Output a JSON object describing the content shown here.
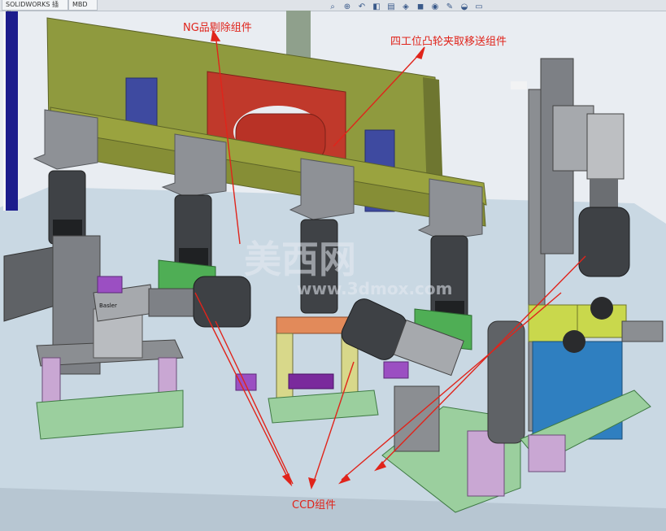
{
  "tabs": [
    "SOLIDWORKS 插件",
    "MBD"
  ],
  "toolbar_icons": [
    "zoom-fit-icon",
    "zoom-area-icon",
    "previous-view-icon",
    "section-view-icon",
    "dynamic-annotation-icon",
    "view-orientation-icon",
    "display-style-icon",
    "hide-show-icon",
    "edit-appearance-icon",
    "apply-scene-icon",
    "view-settings-icon"
  ],
  "annotations": {
    "ng": "NG品剔除组件",
    "cam": "四工位凸轮夹取移送组件",
    "ccd": "CCD组件"
  },
  "watermark": {
    "main": "美西网",
    "url": "www.3dmox.com"
  },
  "labels": {
    "camera_brand": "Basler"
  },
  "colors": {
    "annotation": "#e0241b",
    "plate": "#8f9a3e",
    "base": "#c9d8e3"
  }
}
